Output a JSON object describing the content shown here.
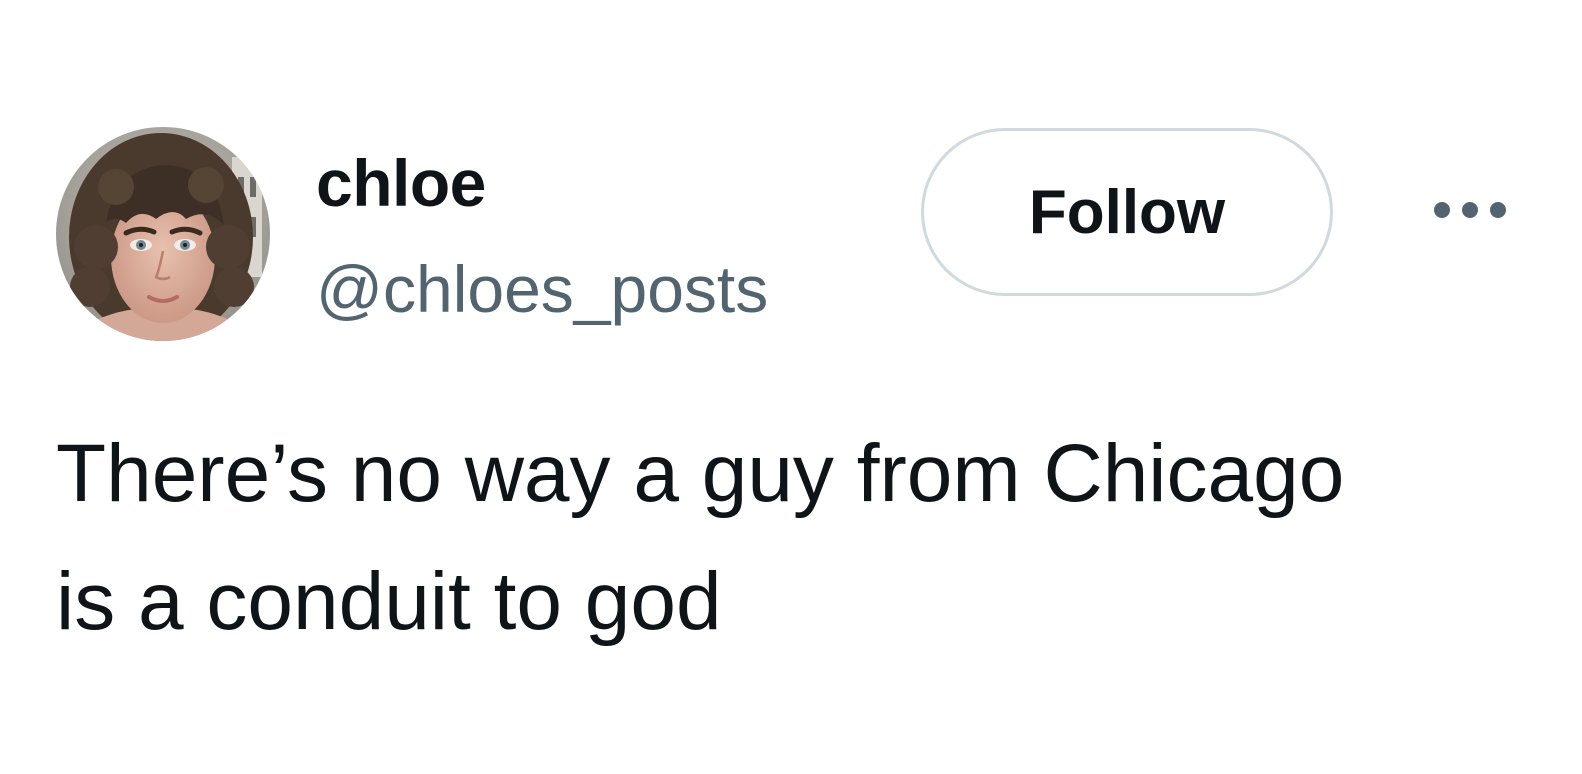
{
  "user": {
    "display_name": "chloe",
    "handle": "@chloes_posts",
    "avatar_icon": "avatar-photo"
  },
  "actions": {
    "follow_label": "Follow",
    "more_icon": "more-horizontal-icon"
  },
  "tweet": {
    "text": "There’s no way a guy from Chicago\nis a conduit to god"
  },
  "colors": {
    "text_primary": "#0f1419",
    "text_secondary": "#536471",
    "button_border": "#cfd9de",
    "background": "#ffffff"
  }
}
